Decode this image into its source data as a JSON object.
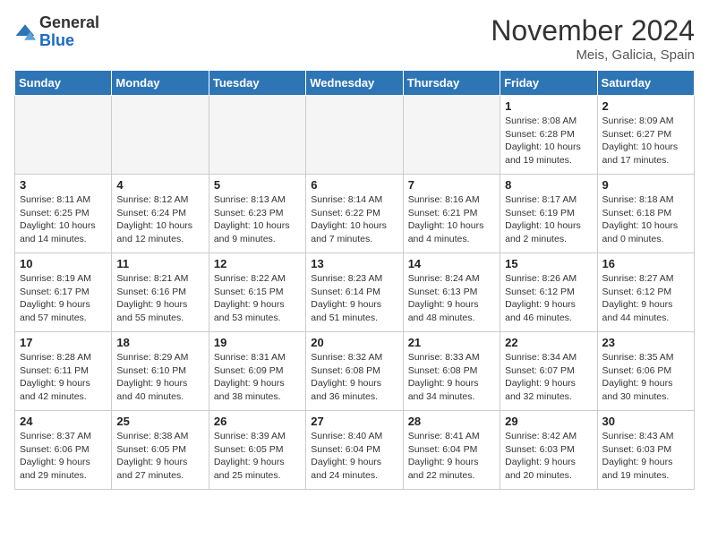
{
  "logo": {
    "general": "General",
    "blue": "Blue"
  },
  "header": {
    "month": "November 2024",
    "location": "Meis, Galicia, Spain"
  },
  "weekdays": [
    "Sunday",
    "Monday",
    "Tuesday",
    "Wednesday",
    "Thursday",
    "Friday",
    "Saturday"
  ],
  "weeks": [
    [
      {
        "day": "",
        "empty": true
      },
      {
        "day": "",
        "empty": true
      },
      {
        "day": "",
        "empty": true
      },
      {
        "day": "",
        "empty": true
      },
      {
        "day": "",
        "empty": true
      },
      {
        "day": "1",
        "sunrise": "8:08 AM",
        "sunset": "6:28 PM",
        "daylight": "10 hours and 19 minutes."
      },
      {
        "day": "2",
        "sunrise": "8:09 AM",
        "sunset": "6:27 PM",
        "daylight": "10 hours and 17 minutes."
      }
    ],
    [
      {
        "day": "3",
        "sunrise": "8:11 AM",
        "sunset": "6:25 PM",
        "daylight": "10 hours and 14 minutes."
      },
      {
        "day": "4",
        "sunrise": "8:12 AM",
        "sunset": "6:24 PM",
        "daylight": "10 hours and 12 minutes."
      },
      {
        "day": "5",
        "sunrise": "8:13 AM",
        "sunset": "6:23 PM",
        "daylight": "10 hours and 9 minutes."
      },
      {
        "day": "6",
        "sunrise": "8:14 AM",
        "sunset": "6:22 PM",
        "daylight": "10 hours and 7 minutes."
      },
      {
        "day": "7",
        "sunrise": "8:16 AM",
        "sunset": "6:21 PM",
        "daylight": "10 hours and 4 minutes."
      },
      {
        "day": "8",
        "sunrise": "8:17 AM",
        "sunset": "6:19 PM",
        "daylight": "10 hours and 2 minutes."
      },
      {
        "day": "9",
        "sunrise": "8:18 AM",
        "sunset": "6:18 PM",
        "daylight": "10 hours and 0 minutes."
      }
    ],
    [
      {
        "day": "10",
        "sunrise": "8:19 AM",
        "sunset": "6:17 PM",
        "daylight": "9 hours and 57 minutes."
      },
      {
        "day": "11",
        "sunrise": "8:21 AM",
        "sunset": "6:16 PM",
        "daylight": "9 hours and 55 minutes."
      },
      {
        "day": "12",
        "sunrise": "8:22 AM",
        "sunset": "6:15 PM",
        "daylight": "9 hours and 53 minutes."
      },
      {
        "day": "13",
        "sunrise": "8:23 AM",
        "sunset": "6:14 PM",
        "daylight": "9 hours and 51 minutes."
      },
      {
        "day": "14",
        "sunrise": "8:24 AM",
        "sunset": "6:13 PM",
        "daylight": "9 hours and 48 minutes."
      },
      {
        "day": "15",
        "sunrise": "8:26 AM",
        "sunset": "6:12 PM",
        "daylight": "9 hours and 46 minutes."
      },
      {
        "day": "16",
        "sunrise": "8:27 AM",
        "sunset": "6:12 PM",
        "daylight": "9 hours and 44 minutes."
      }
    ],
    [
      {
        "day": "17",
        "sunrise": "8:28 AM",
        "sunset": "6:11 PM",
        "daylight": "9 hours and 42 minutes."
      },
      {
        "day": "18",
        "sunrise": "8:29 AM",
        "sunset": "6:10 PM",
        "daylight": "9 hours and 40 minutes."
      },
      {
        "day": "19",
        "sunrise": "8:31 AM",
        "sunset": "6:09 PM",
        "daylight": "9 hours and 38 minutes."
      },
      {
        "day": "20",
        "sunrise": "8:32 AM",
        "sunset": "6:08 PM",
        "daylight": "9 hours and 36 minutes."
      },
      {
        "day": "21",
        "sunrise": "8:33 AM",
        "sunset": "6:08 PM",
        "daylight": "9 hours and 34 minutes."
      },
      {
        "day": "22",
        "sunrise": "8:34 AM",
        "sunset": "6:07 PM",
        "daylight": "9 hours and 32 minutes."
      },
      {
        "day": "23",
        "sunrise": "8:35 AM",
        "sunset": "6:06 PM",
        "daylight": "9 hours and 30 minutes."
      }
    ],
    [
      {
        "day": "24",
        "sunrise": "8:37 AM",
        "sunset": "6:06 PM",
        "daylight": "9 hours and 29 minutes."
      },
      {
        "day": "25",
        "sunrise": "8:38 AM",
        "sunset": "6:05 PM",
        "daylight": "9 hours and 27 minutes."
      },
      {
        "day": "26",
        "sunrise": "8:39 AM",
        "sunset": "6:05 PM",
        "daylight": "9 hours and 25 minutes."
      },
      {
        "day": "27",
        "sunrise": "8:40 AM",
        "sunset": "6:04 PM",
        "daylight": "9 hours and 24 minutes."
      },
      {
        "day": "28",
        "sunrise": "8:41 AM",
        "sunset": "6:04 PM",
        "daylight": "9 hours and 22 minutes."
      },
      {
        "day": "29",
        "sunrise": "8:42 AM",
        "sunset": "6:03 PM",
        "daylight": "9 hours and 20 minutes."
      },
      {
        "day": "30",
        "sunrise": "8:43 AM",
        "sunset": "6:03 PM",
        "daylight": "9 hours and 19 minutes."
      }
    ]
  ]
}
